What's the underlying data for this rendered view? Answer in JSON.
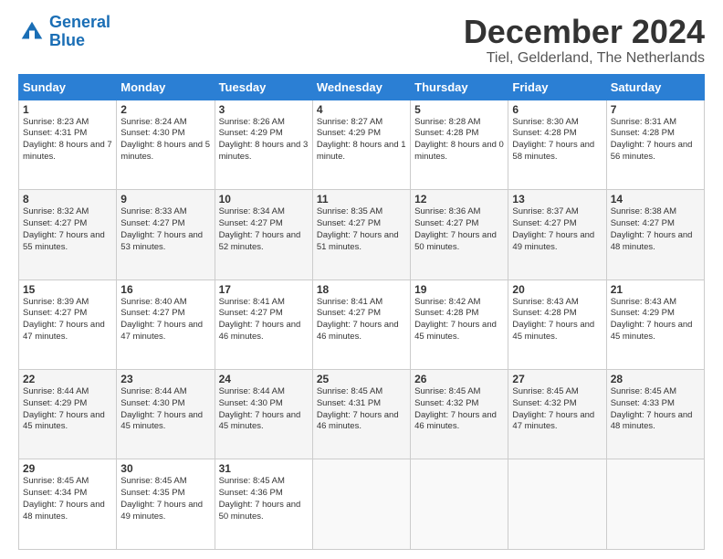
{
  "logo": {
    "line1": "General",
    "line2": "Blue"
  },
  "title": "December 2024",
  "location": "Tiel, Gelderland, The Netherlands",
  "days_of_week": [
    "Sunday",
    "Monday",
    "Tuesday",
    "Wednesday",
    "Thursday",
    "Friday",
    "Saturday"
  ],
  "weeks": [
    [
      {
        "day": "1",
        "sunrise": "8:23 AM",
        "sunset": "4:31 PM",
        "daylight": "8 hours and 7 minutes."
      },
      {
        "day": "2",
        "sunrise": "8:24 AM",
        "sunset": "4:30 PM",
        "daylight": "8 hours and 5 minutes."
      },
      {
        "day": "3",
        "sunrise": "8:26 AM",
        "sunset": "4:29 PM",
        "daylight": "8 hours and 3 minutes."
      },
      {
        "day": "4",
        "sunrise": "8:27 AM",
        "sunset": "4:29 PM",
        "daylight": "8 hours and 1 minute."
      },
      {
        "day": "5",
        "sunrise": "8:28 AM",
        "sunset": "4:28 PM",
        "daylight": "8 hours and 0 minutes."
      },
      {
        "day": "6",
        "sunrise": "8:30 AM",
        "sunset": "4:28 PM",
        "daylight": "7 hours and 58 minutes."
      },
      {
        "day": "7",
        "sunrise": "8:31 AM",
        "sunset": "4:28 PM",
        "daylight": "7 hours and 56 minutes."
      }
    ],
    [
      {
        "day": "8",
        "sunrise": "8:32 AM",
        "sunset": "4:27 PM",
        "daylight": "7 hours and 55 minutes."
      },
      {
        "day": "9",
        "sunrise": "8:33 AM",
        "sunset": "4:27 PM",
        "daylight": "7 hours and 53 minutes."
      },
      {
        "day": "10",
        "sunrise": "8:34 AM",
        "sunset": "4:27 PM",
        "daylight": "7 hours and 52 minutes."
      },
      {
        "day": "11",
        "sunrise": "8:35 AM",
        "sunset": "4:27 PM",
        "daylight": "7 hours and 51 minutes."
      },
      {
        "day": "12",
        "sunrise": "8:36 AM",
        "sunset": "4:27 PM",
        "daylight": "7 hours and 50 minutes."
      },
      {
        "day": "13",
        "sunrise": "8:37 AM",
        "sunset": "4:27 PM",
        "daylight": "7 hours and 49 minutes."
      },
      {
        "day": "14",
        "sunrise": "8:38 AM",
        "sunset": "4:27 PM",
        "daylight": "7 hours and 48 minutes."
      }
    ],
    [
      {
        "day": "15",
        "sunrise": "8:39 AM",
        "sunset": "4:27 PM",
        "daylight": "7 hours and 47 minutes."
      },
      {
        "day": "16",
        "sunrise": "8:40 AM",
        "sunset": "4:27 PM",
        "daylight": "7 hours and 47 minutes."
      },
      {
        "day": "17",
        "sunrise": "8:41 AM",
        "sunset": "4:27 PM",
        "daylight": "7 hours and 46 minutes."
      },
      {
        "day": "18",
        "sunrise": "8:41 AM",
        "sunset": "4:27 PM",
        "daylight": "7 hours and 46 minutes."
      },
      {
        "day": "19",
        "sunrise": "8:42 AM",
        "sunset": "4:28 PM",
        "daylight": "7 hours and 45 minutes."
      },
      {
        "day": "20",
        "sunrise": "8:43 AM",
        "sunset": "4:28 PM",
        "daylight": "7 hours and 45 minutes."
      },
      {
        "day": "21",
        "sunrise": "8:43 AM",
        "sunset": "4:29 PM",
        "daylight": "7 hours and 45 minutes."
      }
    ],
    [
      {
        "day": "22",
        "sunrise": "8:44 AM",
        "sunset": "4:29 PM",
        "daylight": "7 hours and 45 minutes."
      },
      {
        "day": "23",
        "sunrise": "8:44 AM",
        "sunset": "4:30 PM",
        "daylight": "7 hours and 45 minutes."
      },
      {
        "day": "24",
        "sunrise": "8:44 AM",
        "sunset": "4:30 PM",
        "daylight": "7 hours and 45 minutes."
      },
      {
        "day": "25",
        "sunrise": "8:45 AM",
        "sunset": "4:31 PM",
        "daylight": "7 hours and 46 minutes."
      },
      {
        "day": "26",
        "sunrise": "8:45 AM",
        "sunset": "4:32 PM",
        "daylight": "7 hours and 46 minutes."
      },
      {
        "day": "27",
        "sunrise": "8:45 AM",
        "sunset": "4:32 PM",
        "daylight": "7 hours and 47 minutes."
      },
      {
        "day": "28",
        "sunrise": "8:45 AM",
        "sunset": "4:33 PM",
        "daylight": "7 hours and 48 minutes."
      }
    ],
    [
      {
        "day": "29",
        "sunrise": "8:45 AM",
        "sunset": "4:34 PM",
        "daylight": "7 hours and 48 minutes."
      },
      {
        "day": "30",
        "sunrise": "8:45 AM",
        "sunset": "4:35 PM",
        "daylight": "7 hours and 49 minutes."
      },
      {
        "day": "31",
        "sunrise": "8:45 AM",
        "sunset": "4:36 PM",
        "daylight": "7 hours and 50 minutes."
      },
      null,
      null,
      null,
      null
    ]
  ]
}
